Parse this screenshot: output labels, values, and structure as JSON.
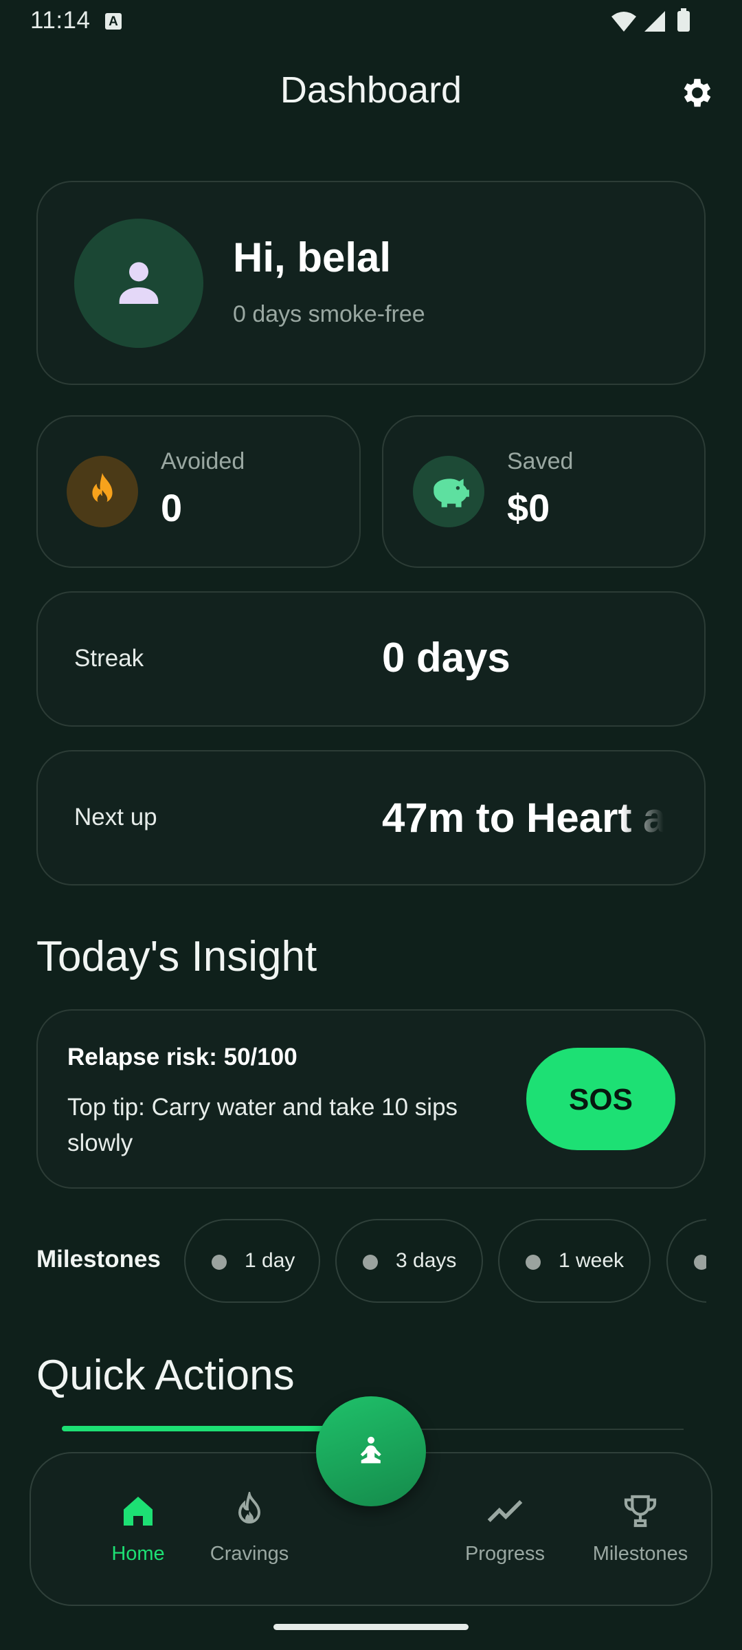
{
  "status_bar": {
    "time": "11:14",
    "notif_badge": "A"
  },
  "header": {
    "title": "Dashboard",
    "settings_icon": "gear-icon"
  },
  "profile": {
    "greeting": "Hi, belal",
    "subtitle": "0 days smoke-free",
    "avatar_icon": "person-icon"
  },
  "stats": {
    "avoided": {
      "label": "Avoided",
      "value": "0",
      "icon": "flame-icon",
      "icon_color": "#f5a623"
    },
    "saved": {
      "label": "Saved",
      "value": "$0",
      "icon": "piggy-bank-icon",
      "icon_color": "#5ee0a0"
    }
  },
  "streak": {
    "label": "Streak",
    "value": "0 days"
  },
  "next_up": {
    "label": "Next up",
    "value": "47m to Heart a"
  },
  "insight": {
    "section_title": "Today's Insight",
    "risk": "Relapse risk: 50/100",
    "tip": "Top tip: Carry water and take 10 sips slowly",
    "sos_label": "SOS"
  },
  "milestones": {
    "label": "Milestones",
    "chips": [
      "1 day",
      "3 days",
      "1 week"
    ]
  },
  "quick_actions": {
    "section_title": "Quick Actions"
  },
  "bottom_nav": {
    "items": [
      {
        "label": "Home",
        "icon": "home-icon",
        "active": true
      },
      {
        "label": "Cravings",
        "icon": "flame-outline-icon",
        "active": false
      },
      {
        "label": "Progress",
        "icon": "trend-line-icon",
        "active": false
      },
      {
        "label": "Milestones",
        "icon": "trophy-icon",
        "active": false
      }
    ],
    "fab_icon": "meditation-icon"
  },
  "colors": {
    "accent": "#1de074",
    "background": "#0f201b",
    "card": "#12221e"
  }
}
